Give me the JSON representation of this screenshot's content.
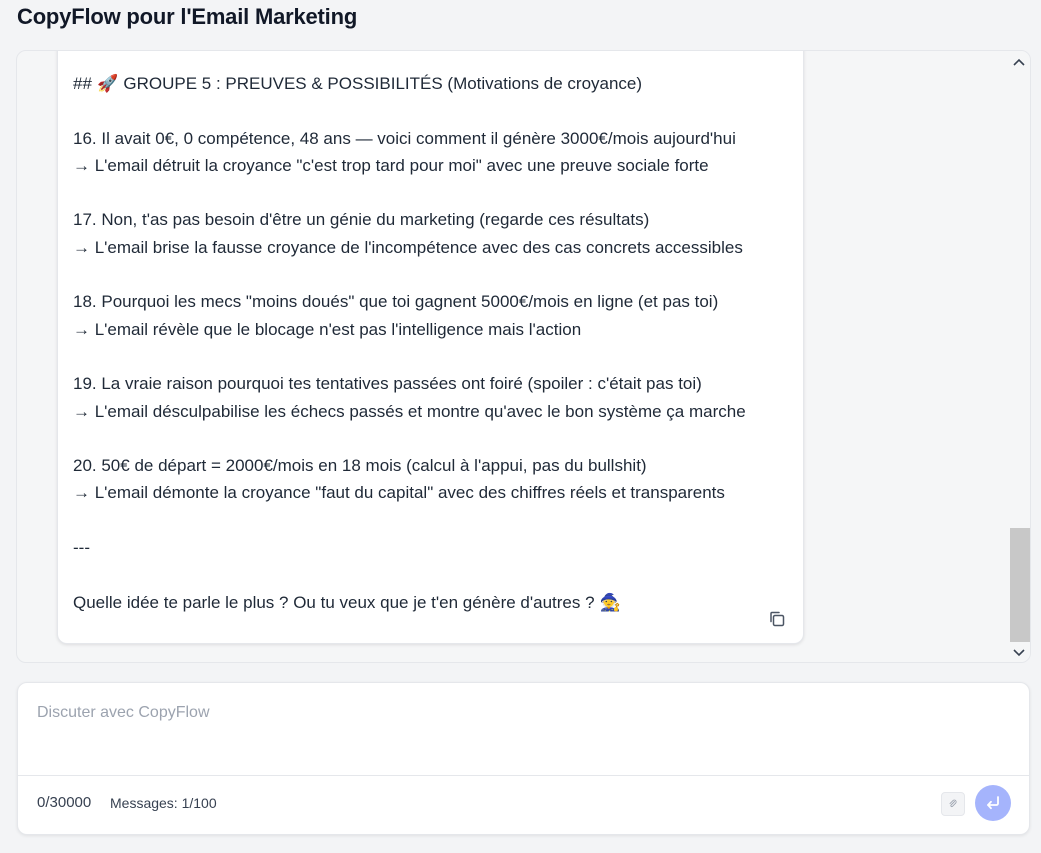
{
  "header": {
    "title": "CopyFlow pour l'Email Marketing"
  },
  "message": {
    "group_heading": {
      "prefix": "## ",
      "emoji": "🚀",
      "text": " GROUPE 5 : PREUVES & POSSIBILITÉS (Motivations de croyance)"
    },
    "items": [
      {
        "title": "16. Il avait 0€, 0 compétence, 48 ans — voici comment il génère 3000€/mois aujourd'hui",
        "detail": "→ L'email détruit la croyance \"c'est trop tard pour moi\" avec une preuve sociale forte"
      },
      {
        "title": "17. Non, t'as pas besoin d'être un génie du marketing (regarde ces résultats)",
        "detail": "→ L'email brise la fausse croyance de l'incompétence avec des cas concrets accessibles"
      },
      {
        "title": "18. Pourquoi les mecs \"moins doués\" que toi gagnent 5000€/mois en ligne (et pas toi)",
        "detail": "→ L'email révèle que le blocage n'est pas l'intelligence mais l'action"
      },
      {
        "title": "19. La vraie raison pourquoi tes tentatives passées ont foiré (spoiler : c'était pas toi)",
        "detail": "→ L'email désculpabilise les échecs passés et montre qu'avec le bon système ça marche"
      },
      {
        "title": "20. 50€ de départ = 2000€/mois en 18 mois (calcul à l'appui, pas du bullshit)",
        "detail": "→ L'email démonte la croyance \"faut du capital\" avec des chiffres réels et transparents"
      }
    ],
    "separator": "---",
    "closing": {
      "text": "Quelle idée te parle le plus ? Ou tu veux que je t'en génère d'autres ? ",
      "emoji": "🧙"
    }
  },
  "scroll": {
    "position_fraction": 0.8,
    "visible_fraction": 0.2
  },
  "composer": {
    "placeholder": "Discuter avec CopyFlow",
    "char_count": "0/30000",
    "messages_count": "Messages: 1/100"
  },
  "icons": {
    "copy": "copy-icon",
    "attach": "attach-icon",
    "send": "send-icon",
    "scroll_up": "chevron-up-icon",
    "scroll_down": "chevron-down-icon"
  },
  "colors": {
    "accent": "#a5b4fc",
    "scroll_thumb": "#c8c8c8"
  }
}
